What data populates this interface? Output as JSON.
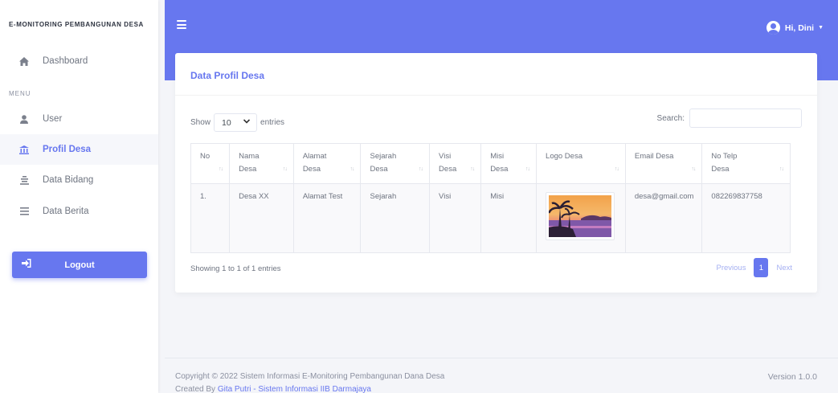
{
  "sidebar": {
    "brand": "E-MONITORING PEMBANGUNAN DESA",
    "menu_header": "MENU",
    "items": [
      {
        "label": "Dashboard",
        "icon": "home-icon"
      },
      {
        "label": "User",
        "icon": "user-icon"
      },
      {
        "label": "Profil Desa",
        "icon": "bank-icon",
        "active": true
      },
      {
        "label": "Data Bidang",
        "icon": "list-stack-icon"
      },
      {
        "label": "Data Berita",
        "icon": "bars-icon"
      }
    ],
    "logout_label": "Logout"
  },
  "topbar": {
    "greeting": "Hi, Dini",
    "accent": "#6777ef"
  },
  "card": {
    "title": "Data Profil Desa",
    "show_label": "Show",
    "entries_value": "10",
    "entries_label": "entries",
    "search_label": "Search:",
    "search_value": "",
    "columns": [
      "No",
      "Nama Desa",
      "Alamat Desa",
      "Sejarah Desa",
      "Visi Desa",
      "Misi Desa",
      "Logo Desa",
      "Email Desa",
      "No Telp Desa"
    ],
    "rows": [
      {
        "no": "1.",
        "nama": "Desa XX",
        "alamat": "Alamat Test",
        "sejarah": "Sejarah",
        "visi": "Visi",
        "misi": "Misi",
        "email": "desa@gmail.com",
        "telp": "082269837758"
      }
    ],
    "info": "Showing 1 to 1 of 1 entries",
    "pagination": {
      "previous": "Previous",
      "current": "1",
      "next": "Next"
    }
  },
  "footer": {
    "copyright": "Copyright © 2022 Sistem Informasi E-Monitoring Pembangunan Dana Desa",
    "created_prefix": "Created By ",
    "created_link": "Gita Putri - Sistem Informasi IIB Darmajaya",
    "version": "Version 1.0.0"
  }
}
